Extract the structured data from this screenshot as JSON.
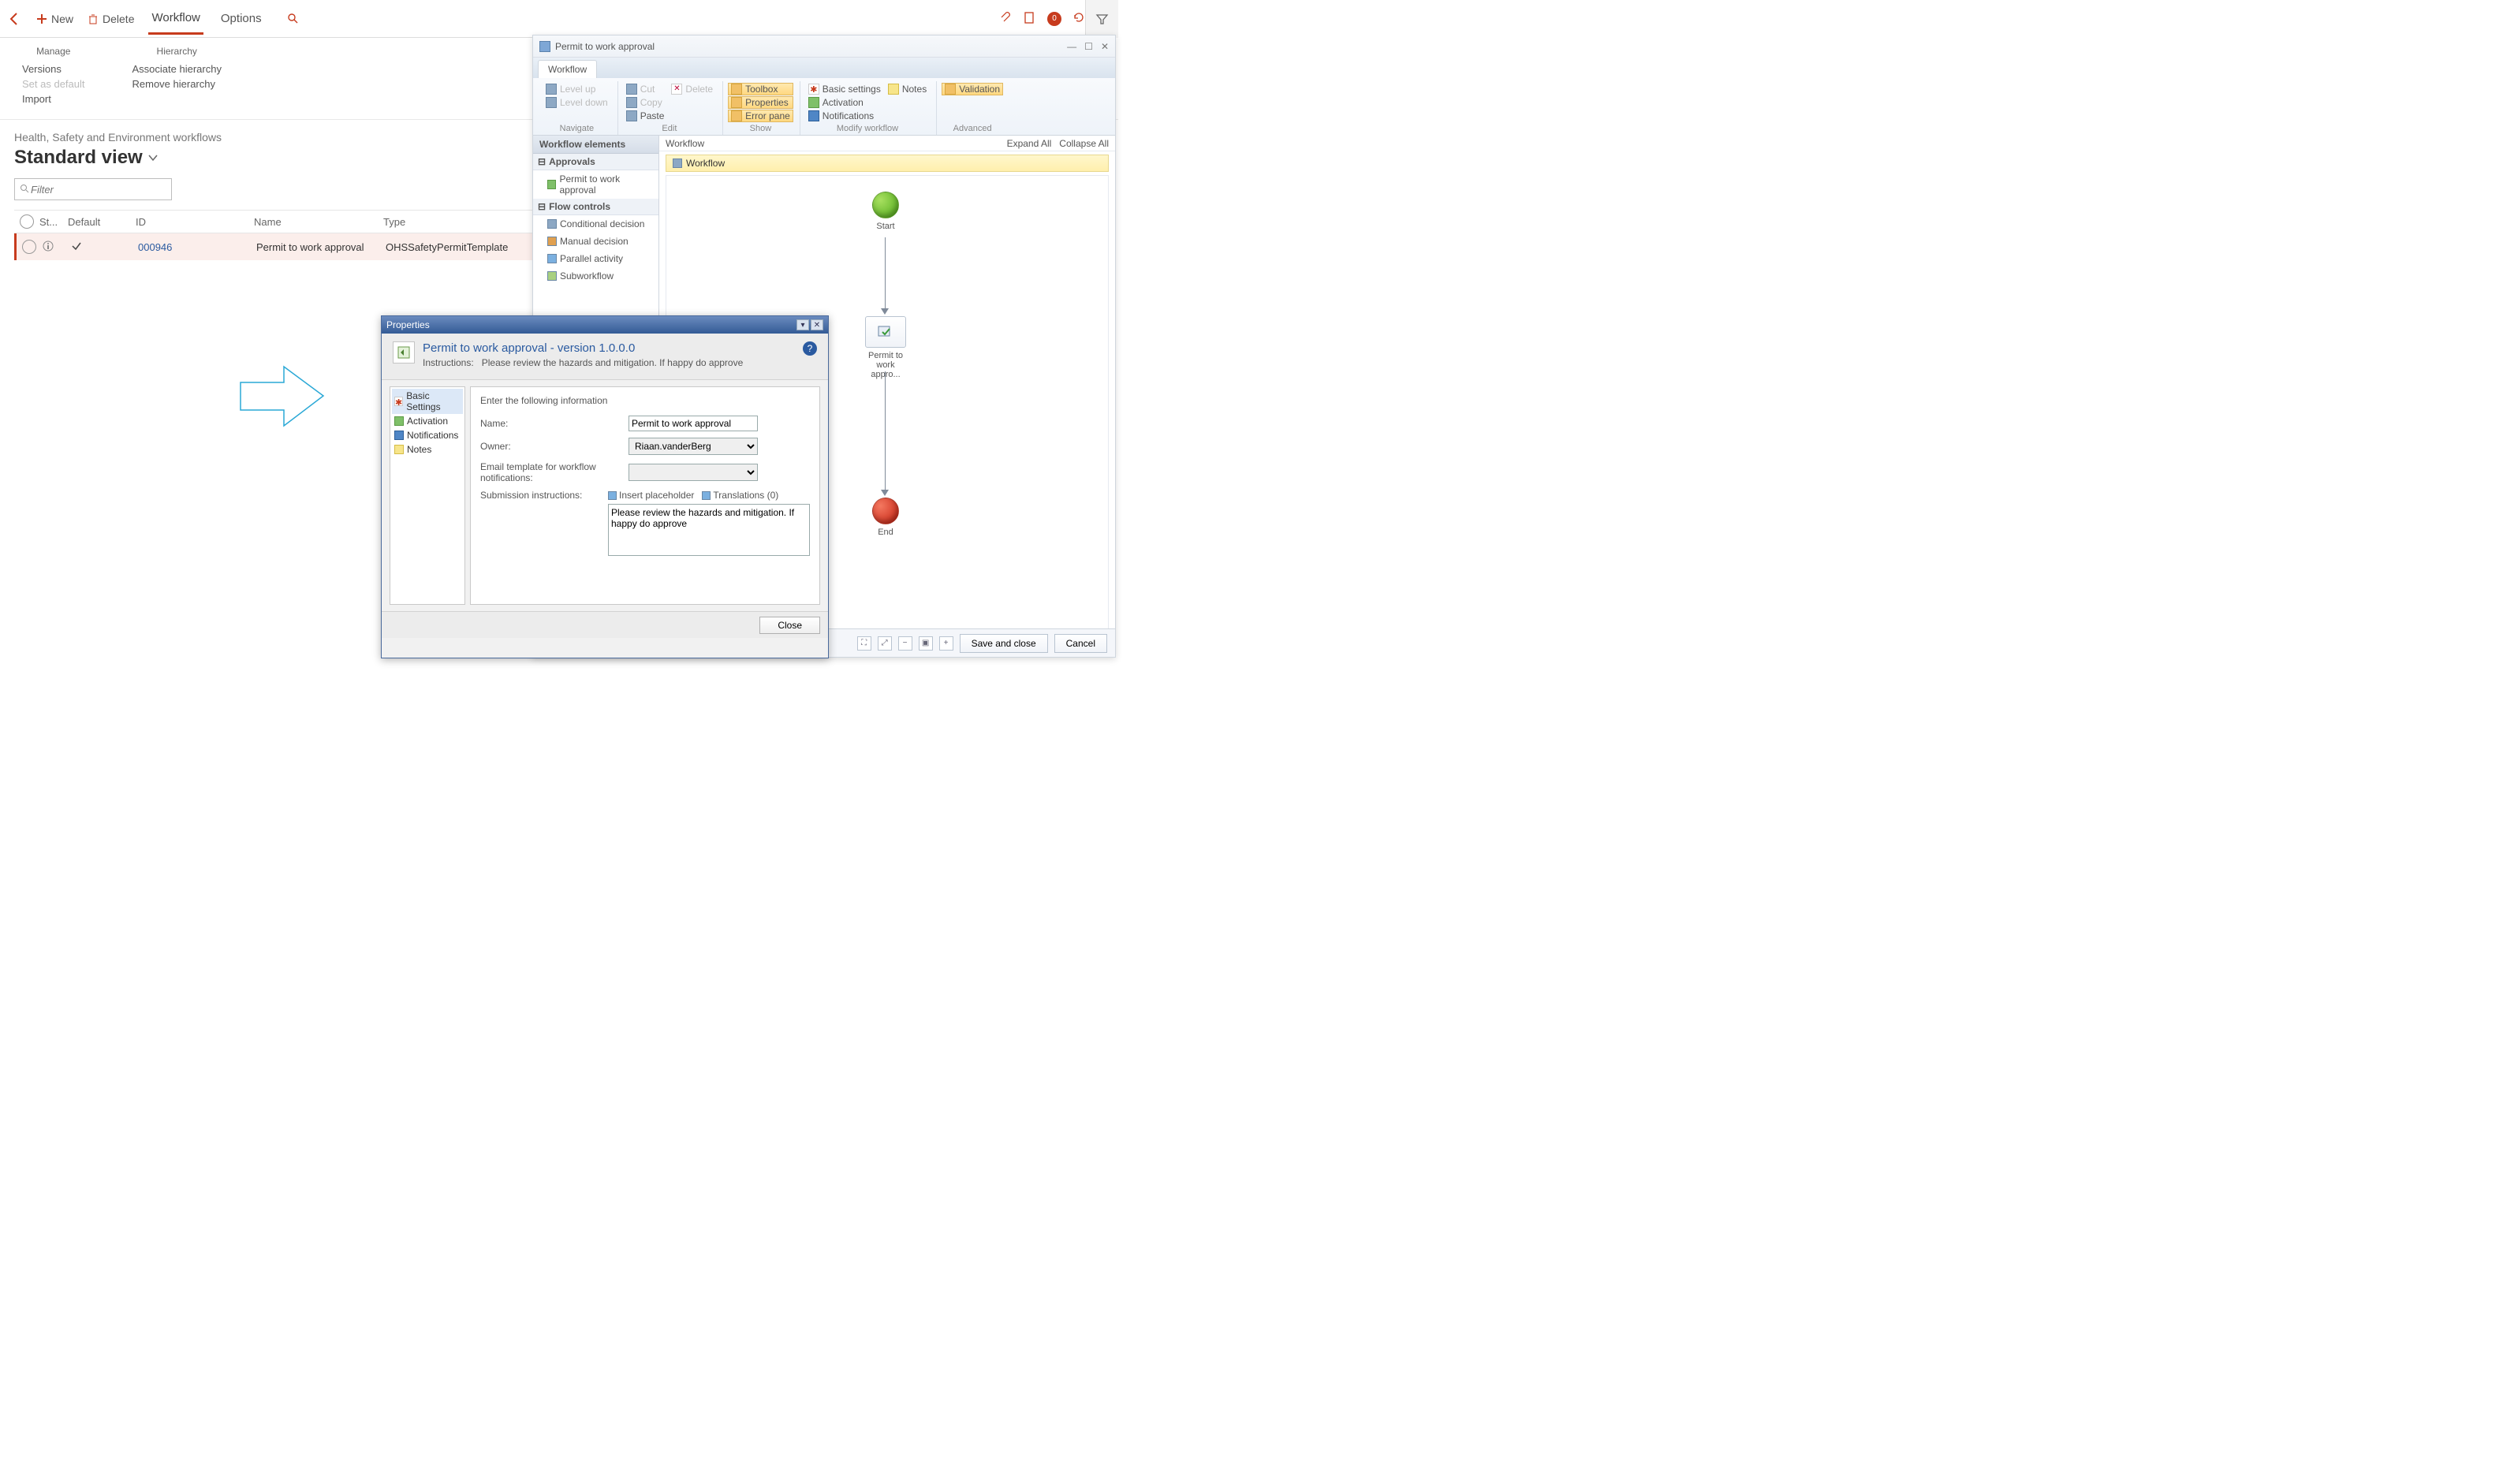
{
  "toolbar": {
    "new_label": "New",
    "delete_label": "Delete",
    "workflow_tab": "Workflow",
    "options_tab": "Options",
    "badge_count": "0"
  },
  "ribbon": {
    "manage": {
      "title": "Manage",
      "versions": "Versions",
      "set_default": "Set as default",
      "import": "Import"
    },
    "hierarchy": {
      "title": "Hierarchy",
      "associate": "Associate hierarchy",
      "remove": "Remove hierarchy"
    }
  },
  "page": {
    "breadcrumb": "Health, Safety and Environment workflows",
    "title": "Standard view",
    "filter_placeholder": "Filter"
  },
  "grid": {
    "headers": {
      "st": "St...",
      "default": "Default",
      "id": "ID",
      "name": "Name",
      "type": "Type"
    },
    "rows": [
      {
        "id": "000946",
        "name": "Permit to work approval",
        "type": "OHSSafetyPermitTemplate"
      }
    ]
  },
  "editor": {
    "window_title": "Permit to work approval",
    "tab": "Workflow",
    "ribbon": {
      "level_up": "Level up",
      "level_down": "Level down",
      "navigate": "Navigate",
      "cut": "Cut",
      "copy": "Copy",
      "paste": "Paste",
      "delete": "Delete",
      "edit": "Edit",
      "toolbox": "Toolbox",
      "properties": "Properties",
      "error_pane": "Error pane",
      "show": "Show",
      "basic_settings": "Basic settings",
      "activation": "Activation",
      "notifications": "Notifications",
      "notes": "Notes",
      "modify": "Modify workflow",
      "validation": "Validation",
      "advanced": "Advanced"
    },
    "elements": {
      "header": "Workflow elements",
      "approvals": "Approvals",
      "permit": "Permit to work approval",
      "flow_controls": "Flow controls",
      "conditional": "Conditional decision",
      "manual": "Manual decision",
      "parallel": "Parallel activity",
      "subworkflow": "Subworkflow"
    },
    "canvas": {
      "header": "Workflow",
      "expand": "Expand All",
      "collapse": "Collapse All",
      "breadcrumb": "Workflow",
      "start": "Start",
      "task": "Permit to work appro...",
      "end": "End"
    },
    "status": {
      "save_close": "Save and close",
      "cancel": "Cancel"
    }
  },
  "properties": {
    "title": "Properties",
    "header_title": "Permit to work approval - version 1.0.0.0",
    "instr_label": "Instructions:",
    "instr_text": "Please review the hazards and mitigation. If happy do approve",
    "nav": {
      "basic": "Basic Settings",
      "activation": "Activation",
      "notifications": "Notifications",
      "notes": "Notes"
    },
    "form": {
      "intro": "Enter the following information",
      "name_label": "Name:",
      "name_value": "Permit to work approval",
      "owner_label": "Owner:",
      "owner_value": "Riaan.vanderBerg",
      "email_label": "Email template for workflow notifications:",
      "email_value": "",
      "submission_label": "Submission instructions:",
      "insert_placeholder": "Insert placeholder",
      "translations": "Translations (0)",
      "submission_text": "Please review the hazards and mitigation. If happy do approve"
    },
    "close": "Close"
  }
}
